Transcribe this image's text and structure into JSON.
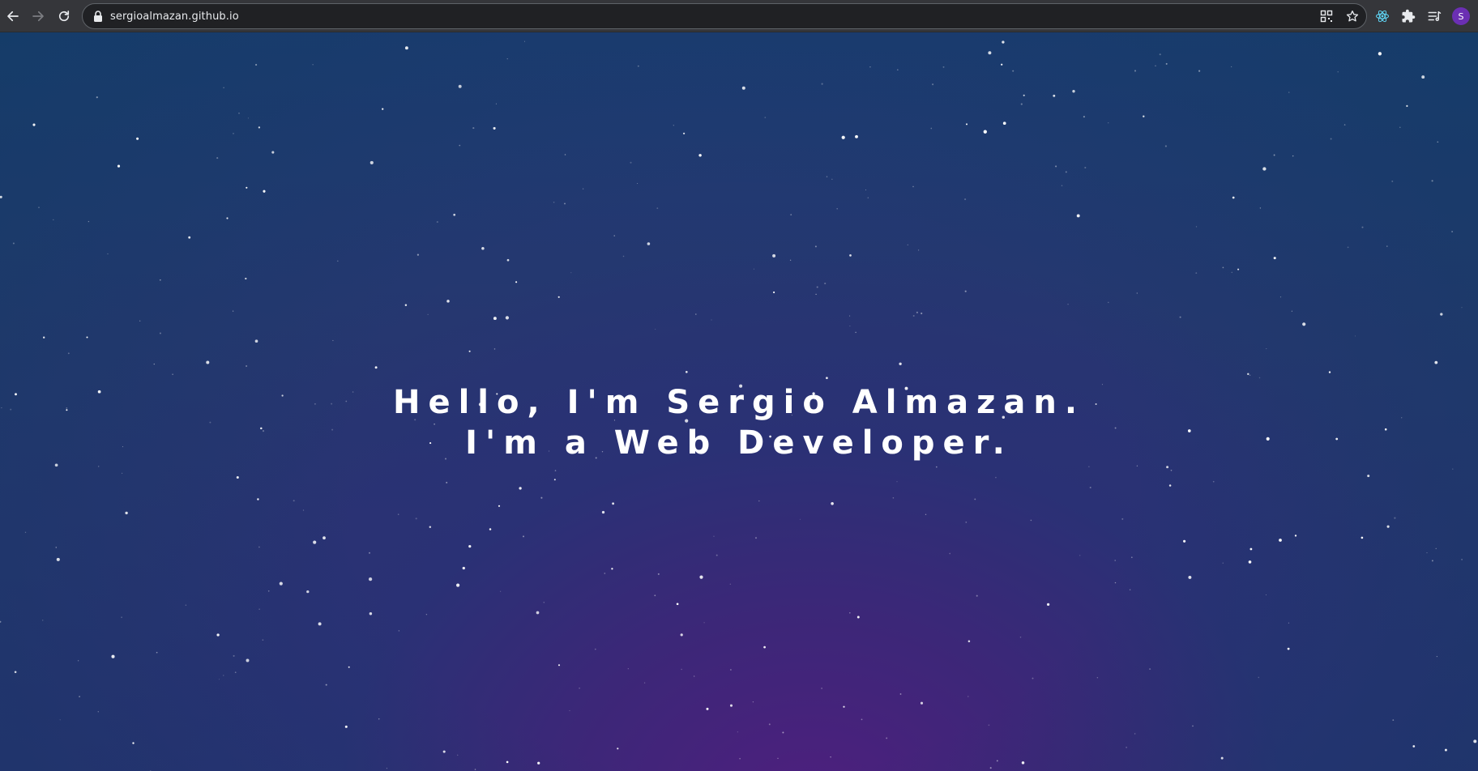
{
  "browser": {
    "url": "sergioalmazan.github.io",
    "nav": {
      "back_icon": "arrow-left-icon",
      "forward_icon": "arrow-right-icon",
      "reload_icon": "reload-icon"
    },
    "omnibox_icons": [
      "lock-icon",
      "qr-code-icon",
      "star-icon"
    ],
    "extension_icons": [
      "react-devtools-icon",
      "puzzle-icon",
      "reading-list-icon"
    ],
    "profile_initial": "S",
    "profile_color": "#6b2fb3"
  },
  "page": {
    "line1": "Hello, I'm Sergio Almazan.",
    "line2": "I'm a Web Developer.",
    "text_color": "#ffffff",
    "background_colors": [
      "#1d3b72",
      "#2c2f74",
      "#4e1f7e"
    ]
  }
}
